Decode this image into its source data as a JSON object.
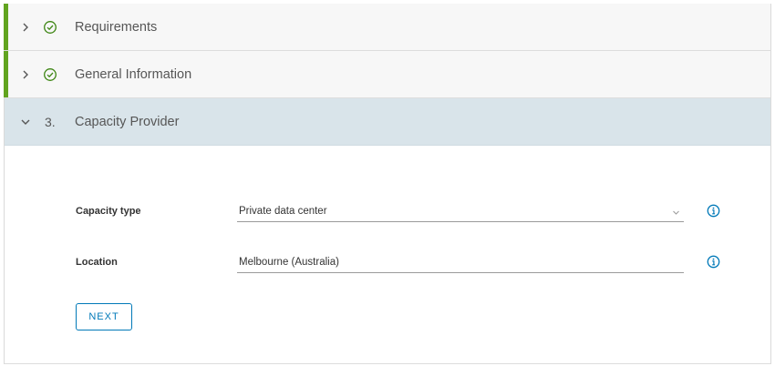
{
  "steps": [
    {
      "title": "Requirements",
      "state": "complete"
    },
    {
      "title": "General Information",
      "state": "complete"
    },
    {
      "number": "3.",
      "title": "Capacity Provider",
      "state": "active"
    }
  ],
  "form": {
    "capacity_type": {
      "label": "Capacity type",
      "value": "Private data center"
    },
    "location": {
      "label": "Location",
      "value": "Melbourne (Australia)"
    },
    "next_label": "NEXT"
  },
  "icons": {
    "collapsed": "chevron-right-icon",
    "expanded": "chevron-down-icon",
    "complete": "check-circle-icon",
    "info": "info-circle-icon",
    "select_caret": "caret-down-icon"
  },
  "colors": {
    "complete": "#62a420",
    "active_header": "#d9e4ea",
    "accent": "#0079b8"
  }
}
